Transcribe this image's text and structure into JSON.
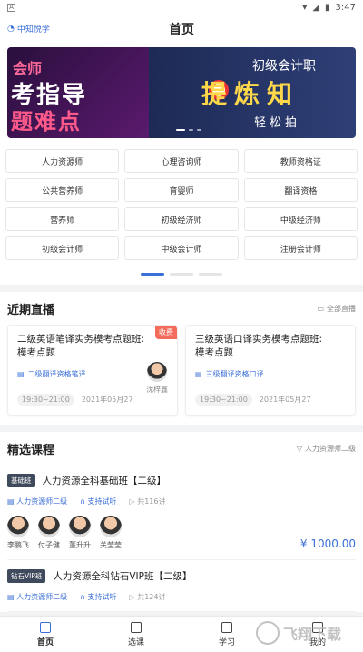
{
  "status": {
    "time": "3:47",
    "left_icon": "A"
  },
  "header": {
    "logo_text": "中知悦学",
    "title": "首页"
  },
  "banner": {
    "left_line1": "会师",
    "left_line2": "考指导",
    "left_line3": "题难点",
    "right_line1": "初级会计职",
    "right_line2": "提炼知",
    "right_line3": "轻松拍"
  },
  "categories": [
    "人力资源师",
    "心理咨询师",
    "教师资格证",
    "公共营养师",
    "育婴师",
    "翻译资格",
    "营养师",
    "初级经济师",
    "中级经济师",
    "初级会计师",
    "中级会计师",
    "注册会计师"
  ],
  "live": {
    "title": "近期直播",
    "more": "全部直播",
    "items": [
      {
        "name": "二级英语笔译实务模考点题班:模考点题",
        "sub": "二级翻译资格笔译",
        "time": "19:30~21:00",
        "date": "2021年05月27",
        "teacher": "沈梓鑫",
        "badge": "收费"
      },
      {
        "name": "三级英语口译实务模考点题班:模考点题",
        "sub": "三级翻译资格口译",
        "time": "19:30~21:00",
        "date": "2021年05月27"
      }
    ]
  },
  "courses": {
    "title": "精选课程",
    "filter": "人力资源师二级",
    "items": [
      {
        "tag": "基础班",
        "name": "人力资源全科基础班【二级】",
        "category": "人力资源师二级",
        "trial": "支持试听",
        "lessons": "共116讲",
        "teachers": [
          "李鹏飞",
          "付子健",
          "董升升",
          "关莹莹"
        ],
        "price": "¥ 1000.00"
      },
      {
        "tag": "钻石VIP班",
        "name": "人力资源全科钻石VIP班【二级】",
        "category": "人力资源师二级",
        "trial": "支持试听",
        "lessons": "共124讲"
      }
    ]
  },
  "tabbar": {
    "home": "首页",
    "select": "选课",
    "study": "学习",
    "mine": "我的"
  },
  "watermark": "飞翔下载"
}
